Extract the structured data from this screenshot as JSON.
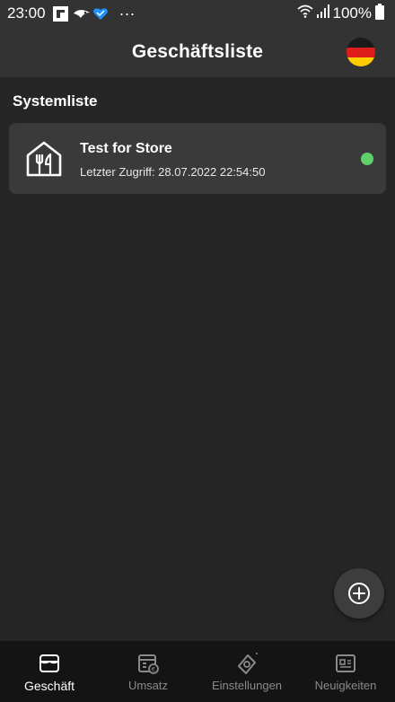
{
  "status_bar": {
    "time": "23:00",
    "overflow": "···",
    "battery": "100%",
    "icons": [
      "flipboard-icon",
      "bird-icon",
      "heart-icon",
      "wifi-icon",
      "signal-icon",
      "battery-icon"
    ]
  },
  "header": {
    "title": "Geschäftsliste",
    "flag_icon": "germany-flag-icon"
  },
  "section": {
    "title": "Systemliste"
  },
  "stores": [
    {
      "name": "Test for Store",
      "last_access": "Letzter Zugriff: 28.07.2022 22:54:50",
      "status_color": "#5fcf6a",
      "icon": "restaurant-house-icon"
    }
  ],
  "fab": {
    "icon": "add-circle-icon"
  },
  "bottom_nav": {
    "active": "Geschäft",
    "items": [
      {
        "label": "Geschäft",
        "icon": "store-icon"
      },
      {
        "label": "Umsatz",
        "icon": "revenue-icon"
      },
      {
        "label": "Einstellungen",
        "icon": "settings-ticket-icon"
      },
      {
        "label": "Neuigkeiten",
        "icon": "news-icon"
      }
    ]
  },
  "colors": {
    "background": "#262626",
    "bar": "#333333",
    "card": "#3a3a3a",
    "nav": "#141414",
    "inactive": "#8a8a8a"
  }
}
